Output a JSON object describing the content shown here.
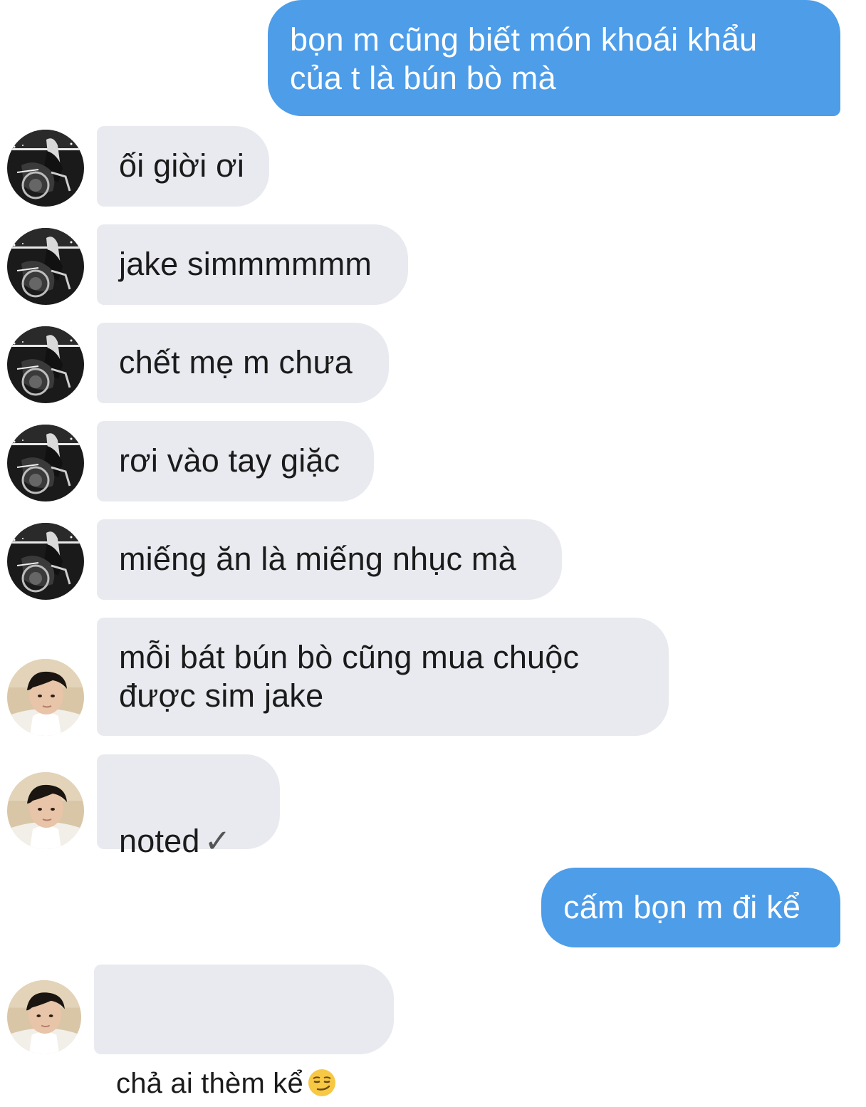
{
  "messages": [
    {
      "text": "bọn m cũng biết món khoái khẩu\ncủa t là bún bò mà"
    },
    {
      "text": "ối giời ơi"
    },
    {
      "text": "jake simmmmmm"
    },
    {
      "text": "chết mẹ m chưa"
    },
    {
      "text": "rơi vào tay giặc"
    },
    {
      "text": "miếng ăn là miếng nhục mà"
    },
    {
      "text": "mỗi bát bún bò cũng mua chuộc\nđược sim jake"
    },
    {
      "text": "noted",
      "suffix": "✓"
    },
    {
      "text": "cấm bọn m đi kể"
    },
    {
      "text": "chả ai thèm kể",
      "emoji": "smirking-face"
    }
  ],
  "colors": {
    "outgoing": "#4d9de9",
    "incoming": "#e8eaef"
  },
  "avatars": {
    "dark": "bw-motorcycle-photo",
    "beach": "person-on-beach-photo"
  }
}
